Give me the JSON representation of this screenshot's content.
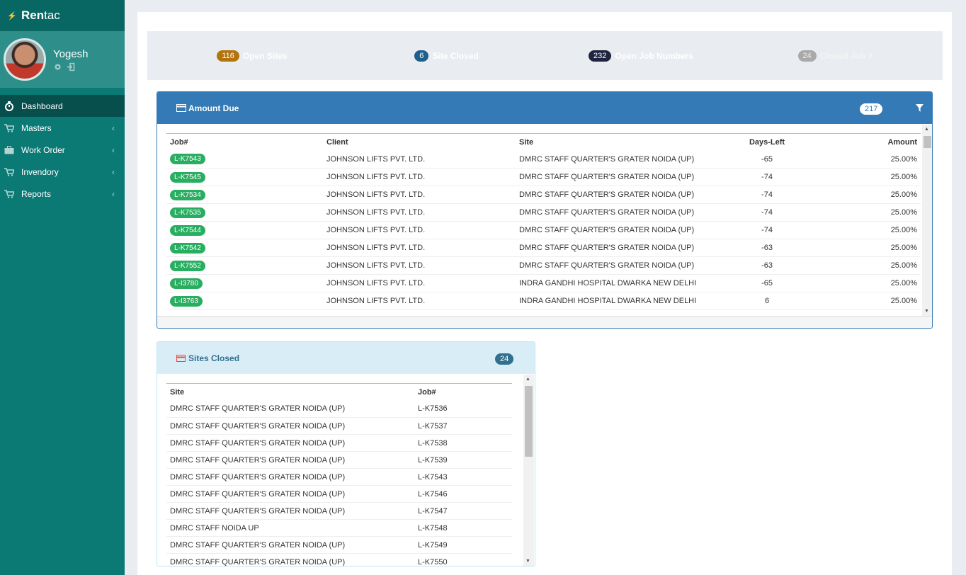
{
  "sidebar": {
    "brand_bold": "Ren",
    "brand_rest": "tac",
    "user_name": "Yogesh",
    "menu": [
      {
        "label": "Dashboard",
        "icon": "stopwatch-icon",
        "active": true
      },
      {
        "label": "Masters",
        "icon": "cart-icon"
      },
      {
        "label": "Work Order",
        "icon": "briefcase-icon"
      },
      {
        "label": "Invendory",
        "icon": "cart-icon"
      },
      {
        "label": "Reports",
        "icon": "cart-icon"
      }
    ]
  },
  "stats": [
    {
      "count": "116",
      "label": "Open Sites",
      "bg": "#f39c12"
    },
    {
      "count": "6",
      "label": "Site Closed",
      "bg": "#3498db"
    },
    {
      "count": "232",
      "label": "Open Job Numbers",
      "bg": "#3a4165"
    },
    {
      "count": "24",
      "label": "Closed Job #",
      "bg": "#d9d9d9"
    }
  ],
  "amount_due": {
    "title": "Amount Due",
    "count": "217",
    "columns": [
      "Job#",
      "Client",
      "Site",
      "Days-Left",
      "Amount"
    ],
    "rows": [
      [
        "L-K7543",
        "JOHNSON LIFTS PVT. LTD.",
        "DMRC STAFF QUARTER'S GRATER NOIDA (UP)",
        "-65",
        "25.00%"
      ],
      [
        "L-K7545",
        "JOHNSON LIFTS PVT. LTD.",
        "DMRC STAFF QUARTER'S GRATER NOIDA (UP)",
        "-74",
        "25.00%"
      ],
      [
        "L-K7534",
        "JOHNSON LIFTS PVT. LTD.",
        "DMRC STAFF QUARTER'S GRATER NOIDA (UP)",
        "-74",
        "25.00%"
      ],
      [
        "L-K7535",
        "JOHNSON LIFTS PVT. LTD.",
        "DMRC STAFF QUARTER'S GRATER NOIDA (UP)",
        "-74",
        "25.00%"
      ],
      [
        "L-K7544",
        "JOHNSON LIFTS PVT. LTD.",
        "DMRC STAFF QUARTER'S GRATER NOIDA (UP)",
        "-74",
        "25.00%"
      ],
      [
        "L-K7542",
        "JOHNSON LIFTS PVT. LTD.",
        "DMRC STAFF QUARTER'S GRATER NOIDA (UP)",
        "-63",
        "25.00%"
      ],
      [
        "L-K7552",
        "JOHNSON LIFTS PVT. LTD.",
        "DMRC STAFF QUARTER'S GRATER NOIDA (UP)",
        "-63",
        "25.00%"
      ],
      [
        "L-I3780",
        "JOHNSON LIFTS PVT. LTD.",
        "INDRA GANDHI HOSPITAL DWARKA NEW DELHI",
        "-65",
        "25.00%"
      ],
      [
        "L-I3763",
        "JOHNSON LIFTS PVT. LTD.",
        "INDRA GANDHI HOSPITAL DWARKA NEW DELHI",
        "6",
        "25.00%"
      ]
    ]
  },
  "sites_closed": {
    "title": "Sites Closed",
    "count": "24",
    "columns": [
      "Site",
      "Job#"
    ],
    "rows": [
      [
        "DMRC STAFF QUARTER'S GRATER NOIDA (UP)",
        "L-K7536"
      ],
      [
        "DMRC STAFF QUARTER'S GRATER NOIDA (UP)",
        "L-K7537"
      ],
      [
        "DMRC STAFF QUARTER'S GRATER NOIDA (UP)",
        "L-K7538"
      ],
      [
        "DMRC STAFF QUARTER'S GRATER NOIDA (UP)",
        "L-K7539"
      ],
      [
        "DMRC STAFF QUARTER'S GRATER NOIDA (UP)",
        "L-K7543"
      ],
      [
        "DMRC STAFF QUARTER'S GRATER NOIDA (UP)",
        "L-K7546"
      ],
      [
        "DMRC STAFF QUARTER'S GRATER NOIDA (UP)",
        "L-K7547"
      ],
      [
        "DMRC STAFF NOIDA UP",
        "L-K7548"
      ],
      [
        "DMRC STAFF QUARTER'S GRATER NOIDA (UP)",
        "L-K7549"
      ],
      [
        "DMRC STAFF QUARTER'S GRATER NOIDA (UP)",
        "L-K7550"
      ]
    ]
  }
}
